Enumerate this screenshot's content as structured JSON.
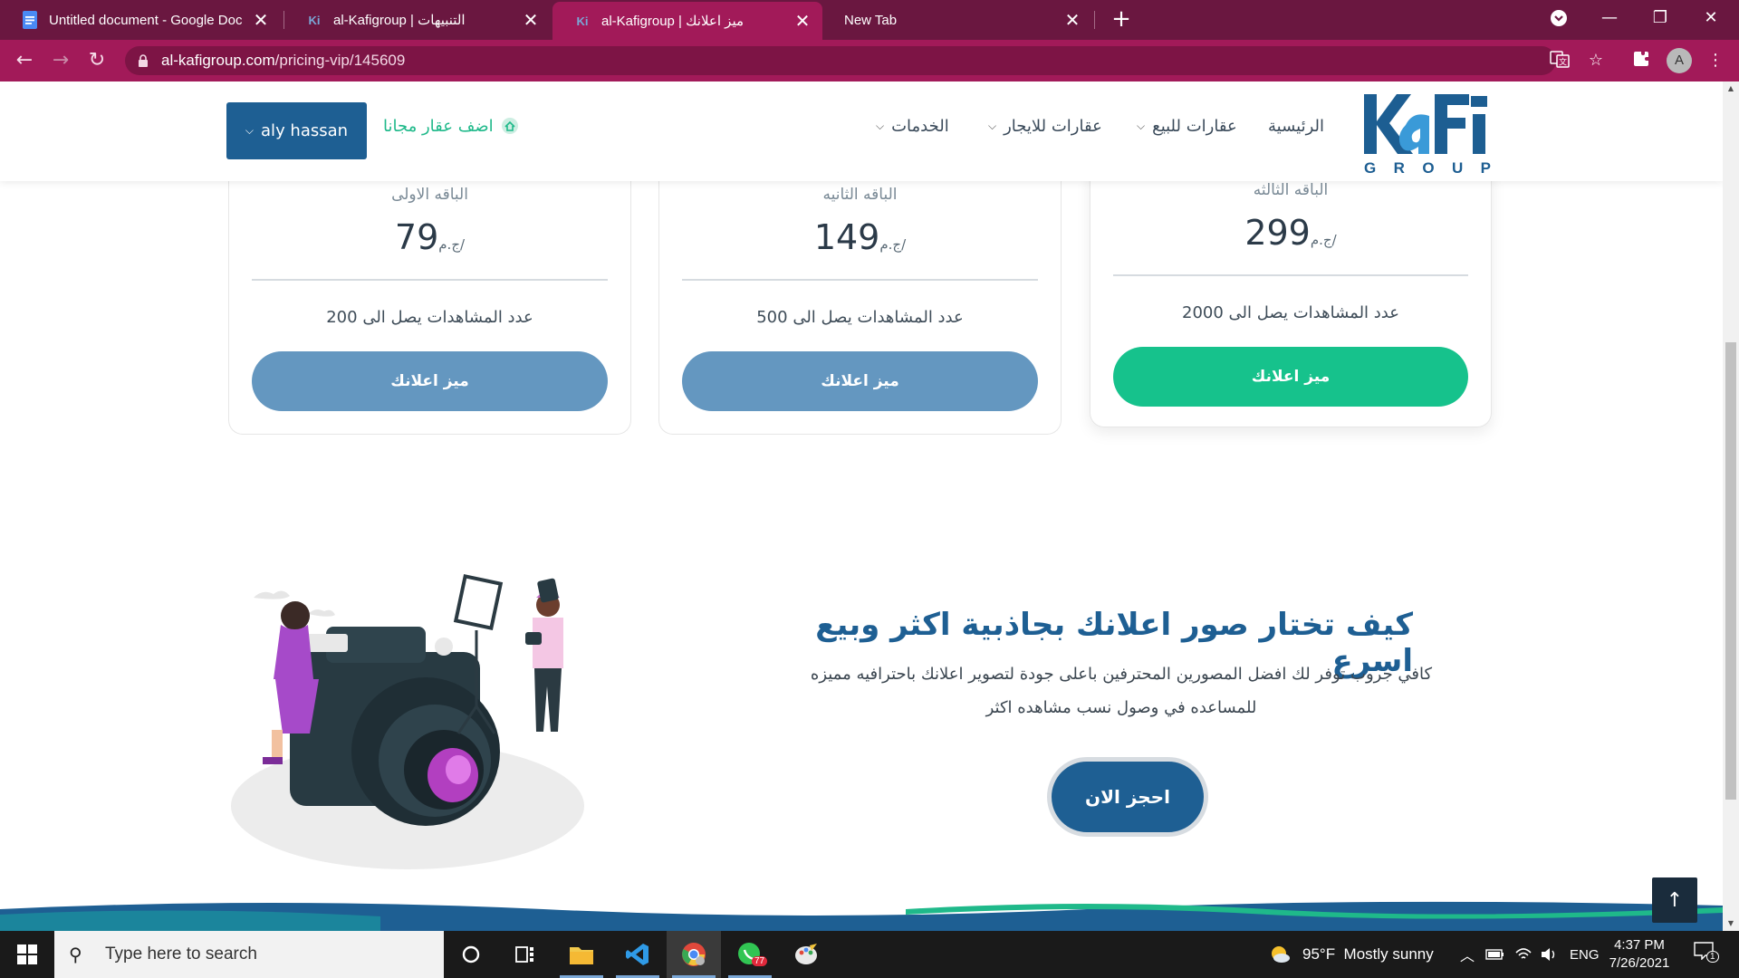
{
  "browser": {
    "tabs": [
      {
        "title": "Untitled document - Google Doc",
        "icon": "docs-icon",
        "active": false
      },
      {
        "title": "al-Kafigroup | التنبيهات",
        "icon": "kafi-icon",
        "active": false
      },
      {
        "title": "al-Kafigroup | ميز اعلانك",
        "icon": "kafi-icon",
        "active": true
      },
      {
        "title": "New Tab",
        "icon": "",
        "active": false
      }
    ],
    "close_glyph": "✕",
    "new_tab_glyph": "+",
    "url_host": "al-kafigroup.com",
    "url_path": "/pricing-vip/145609",
    "profile_initial": "A",
    "theme_color": "#a21a59"
  },
  "header": {
    "logo_text": "KaFi",
    "logo_sub": [
      "G",
      "R",
      "O",
      "U",
      "P"
    ],
    "menu": [
      {
        "label": "الرئيسية",
        "has_caret": false
      },
      {
        "label": "عقارات للبيع",
        "has_caret": true
      },
      {
        "label": "عقارات للايجار",
        "has_caret": true
      },
      {
        "label": "الخدمات",
        "has_caret": true
      }
    ],
    "add_free": "اضف عقار مجانا",
    "user_name": "aly hassan",
    "brand_color": "#1e5f93",
    "accent_color": "#1fb98a"
  },
  "pricing": {
    "currency": "ج.م/",
    "cards": [
      {
        "plan": "الباقه الاولى",
        "price": "79",
        "views": "عدد المشاهدات يصل الى 200",
        "cta": "ميز اعلانك",
        "cta_color": "#6497c0"
      },
      {
        "plan": "الباقه الثانيه",
        "price": "149",
        "views": "عدد المشاهدات يصل الى 500",
        "cta": "ميز اعلانك",
        "cta_color": "#6497c0"
      },
      {
        "plan": "الباقه الثالثه",
        "price": "299",
        "views": "عدد المشاهدات يصل الى 2000",
        "cta": "ميز اعلانك",
        "cta_color": "#16c28c"
      }
    ]
  },
  "feature": {
    "title": "كيف تختار صور اعلانك بجاذبية اكثر وبيع اسرع",
    "text": "كافي جروب توفر لك افضل المصورين المحترفين باعلى جودة لتصوير اعلانك باحترافيه مميزه للمساعده في وصول نسب مشاهده اكثر",
    "button": "احجز الان"
  },
  "taskbar": {
    "search_placeholder": "Type here to search",
    "weather": "95°F  Mostly sunny",
    "language": "ENG",
    "time": "4:37 PM",
    "date": "7/26/2021",
    "whatsapp_badge": "77",
    "notification_count": "1"
  }
}
